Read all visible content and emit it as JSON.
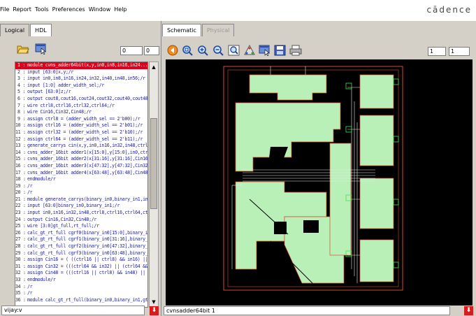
{
  "menu": {
    "items": [
      "File",
      "Report",
      "Tools",
      "Preferences",
      "Window",
      "Help"
    ],
    "brand": "cādence"
  },
  "left_panel": {
    "tabs": [
      "Logical",
      "HDL"
    ],
    "toolbar_field_1": "0",
    "toolbar_field_2": "0",
    "status_text": "vijay:v"
  },
  "code_lines": [
    {
      "n": "1 :",
      "t": "module cvns_adder64bit(x,y,in0,in8,in16,in24..."
    },
    {
      "n": "2 :",
      "t": "input [63:0]x,y;/r"
    },
    {
      "n": "3 :",
      "t": "input in0,in8,in16,in24,in32,in40,in48,in56;/r"
    },
    {
      "n": "4 :",
      "t": "input [1:0] adder_width_sel;/r"
    },
    {
      "n": "5 :",
      "t": "output [63:0]z;/r"
    },
    {
      "n": "6 :",
      "t": "output cout8,cout16,cout24,cout32,cout40,cout48,c"
    },
    {
      "n": "7 :",
      "t": "wire ctrl8,ctrl16,ctrl32,ctrl64;/r"
    },
    {
      "n": "8 :",
      "t": "wire Cin16,Cin32,Cin48;/r"
    },
    {
      "n": "9 :",
      "t": "assign ctrl8 = (adder_width_sel == 2'b00);/r"
    },
    {
      "n": "10 :",
      "t": "assign ctrl16 = (adder_width_sel == 2'b01);/r"
    },
    {
      "n": "11 :",
      "t": "assign ctrl32 = (adder_width_sel == 2'b10);/r"
    },
    {
      "n": "12 :",
      "t": "assign ctrl64 = (adder_width_sel == 2'b11);/r"
    },
    {
      "n": "13 :",
      "t": "generate_carrys cin(x,y,in0,in16,in32,in48,ctrl8,ctrl"
    },
    {
      "n": "14 :",
      "t": "cvns_adder_16bit adder1(x[15:0],y[15:0],in0,ctrl8,in"
    },
    {
      "n": "15 :",
      "t": "cvns_adder_16bit adder2(x[31:16],y[31:16],Cin16,c"
    },
    {
      "n": "16 :",
      "t": "cvns_adder_16bit adder3(x[47:32],y[47:32],Cin32,c"
    },
    {
      "n": "17 :",
      "t": "cvns_adder_16bit adder4(x[63:48],y[63:48],Cin48,c"
    },
    {
      "n": "18 :",
      "t": "endmodule/r"
    },
    {
      "n": "19 :",
      "t": "/r"
    },
    {
      "n": "20 :",
      "t": "/r"
    },
    {
      "n": "21 :",
      "t": "module generate_carrys(binary_in0,binary_in1,in0,in"
    },
    {
      "n": "22 :",
      "t": "input [63:0]binary_in0,binary_in1;/r"
    },
    {
      "n": "23 :",
      "t": "input in0,in16,in32,in48,ctrl8,ctrl16,ctrl64,ctrl32;/r"
    },
    {
      "n": "24 :",
      "t": "output Cin16,Cin32,Cin48;/r"
    },
    {
      "n": "25 :",
      "t": "wire [3:0]gt_full,rt_full;/r"
    },
    {
      "n": "26 :",
      "t": "calc_gt_rt_full cgrf0(binary_in0[15:0],binary_in1[1"
    },
    {
      "n": "27 :",
      "t": "calc_gt_rt_full cgrf1(binary_in0[31:16],binary_in1[3"
    },
    {
      "n": "28 :",
      "t": "calc_gt_rt_full cgrf2(binary_in0[47:32],binary_in1[4"
    },
    {
      "n": "29 :",
      "t": "calc_gt_rt_full cgrf3(binary_in0[63:48],binary_in1[6"
    },
    {
      "n": "30 :",
      "t": "assign Cin16 = ( ((ctrl16 || ctrl8) && in16) || ( (ctrl32"
    },
    {
      "n": "31 :",
      "t": "assign Cin32 = (((ctrl64 && in32) || (ctrl64 && (gt_"
    },
    {
      "n": "32 :",
      "t": "assign Cin48 = (((ctrl16 || ctrl8) && in48) || ((ctrl32 &"
    },
    {
      "n": "33 :",
      "t": "endmodule/r"
    },
    {
      "n": "34 :",
      "t": "/r"
    },
    {
      "n": "35 :",
      "t": "/r"
    },
    {
      "n": "36 :",
      "t": "module calc_gt_rt_full(binary_in0,binary_in1,gt_ful"
    }
  ],
  "right_panel": {
    "tabs": [
      "Schematic",
      "Physical"
    ],
    "field_1": "1",
    "field_2": "1",
    "status_text": "cvnsadder64bit 1"
  },
  "colors": {
    "highlight": "#e0001b",
    "schematic_fill": "#b8f0b8",
    "schematic_border": "#d94a2a"
  }
}
